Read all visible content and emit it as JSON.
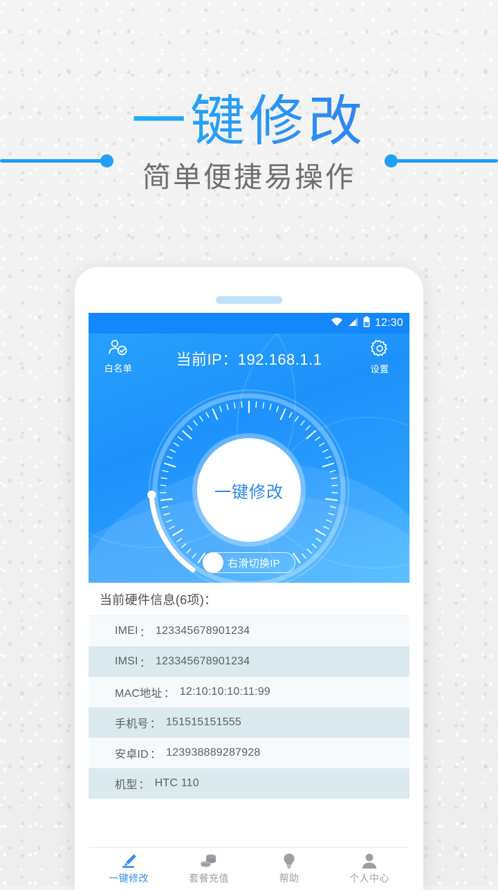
{
  "promo": {
    "headline": "一键修改",
    "subhead": "简单便捷易操作",
    "accent_color": "#1e9cf5",
    "headline_gradient_from": "#19b9ff",
    "headline_gradient_to": "#2f7ae8"
  },
  "status_bar": {
    "time": "12:30",
    "icons": [
      "wifi-icon",
      "cellular-signal-icon",
      "battery-icon"
    ],
    "background_color": "#1387fc"
  },
  "hero": {
    "title": "当前IP：192.168.1.1",
    "left_button": {
      "label": "白名单",
      "icon": "person-check-icon"
    },
    "right_button": {
      "label": "设置",
      "icon": "gear-icon"
    },
    "gauge": {
      "center_label": "一键修改",
      "center_label_color": "#2d86e8",
      "progress_percent": 18,
      "tick_count": 60
    },
    "slide_toggle": {
      "label": "右滑切换IP",
      "knob_position": "left"
    },
    "background_color": "#1e92fb"
  },
  "info_panel": {
    "header": "当前硬件信息(6项)：",
    "rows": [
      {
        "key": "IMEI",
        "value": "123345678901234"
      },
      {
        "key": "IMSI",
        "value": "123345678901234"
      },
      {
        "key": "MAC地址",
        "value": "12:10:10:10:11:99"
      },
      {
        "key": "手机号",
        "value": "151515151555"
      },
      {
        "key": "安卓ID",
        "value": "123938889287928"
      },
      {
        "key": "机型",
        "value": "HTC 110"
      }
    ],
    "separator": "："
  },
  "bottom_nav": {
    "items": [
      {
        "label": "一键修改",
        "icon": "pencil-icon",
        "active": true
      },
      {
        "label": "套餐充值",
        "icon": "coins-icon",
        "active": false
      },
      {
        "label": "帮助",
        "icon": "lightbulb-icon",
        "active": false
      },
      {
        "label": "个人中心",
        "icon": "person-icon",
        "active": false
      }
    ],
    "active_color": "#2f8eea",
    "inactive_color": "#9aa0a6"
  }
}
